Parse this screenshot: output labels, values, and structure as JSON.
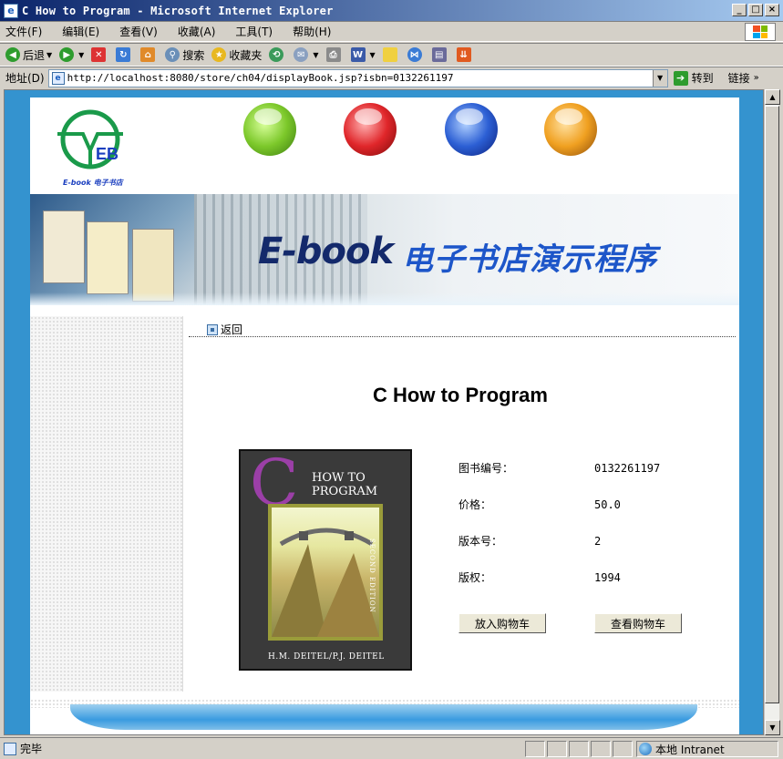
{
  "window": {
    "title": "C How to Program - Microsoft Internet Explorer",
    "controls": {
      "minimize": "_",
      "maximize": "□",
      "close": "×"
    }
  },
  "menubar": [
    "文件(F)",
    "编辑(E)",
    "查看(V)",
    "收藏(A)",
    "工具(T)",
    "帮助(H)"
  ],
  "toolbar": {
    "back": "后退",
    "search": "搜索",
    "favorites": "收藏夹"
  },
  "address": {
    "label": "地址(D)",
    "url": "http://localhost:8080/store/ch04/displayBook.jsp?isbn=0132261197",
    "go": "转到",
    "links": "链接"
  },
  "site": {
    "logo_text": "E-book 电子书店",
    "logo_letters": "EB",
    "banner_en": "E-book",
    "banner_cn": "电子书店演示程序",
    "orb_colors": [
      "#7cc82a",
      "#e0262a",
      "#2c5fd4",
      "#f0a020"
    ]
  },
  "page": {
    "back_link": "返回",
    "book_title": "C How to Program",
    "cover": {
      "letter": "C",
      "line1": "HOW TO",
      "line2": "PROGRAM",
      "edition": "SECOND EDITION",
      "authors": "H.M. DEITEL/P.J. DEITEL"
    },
    "fields": [
      {
        "label": "图书编号：",
        "value": "0132261197"
      },
      {
        "label": "价格：",
        "value": "50.0"
      },
      {
        "label": "版本号：",
        "value": "2"
      },
      {
        "label": "版权：",
        "value": "1994"
      }
    ],
    "buttons": {
      "add_to_cart": "放入购物车",
      "view_cart": "查看购物车"
    }
  },
  "statusbar": {
    "status": "完毕",
    "zone": "本地 Intranet"
  }
}
